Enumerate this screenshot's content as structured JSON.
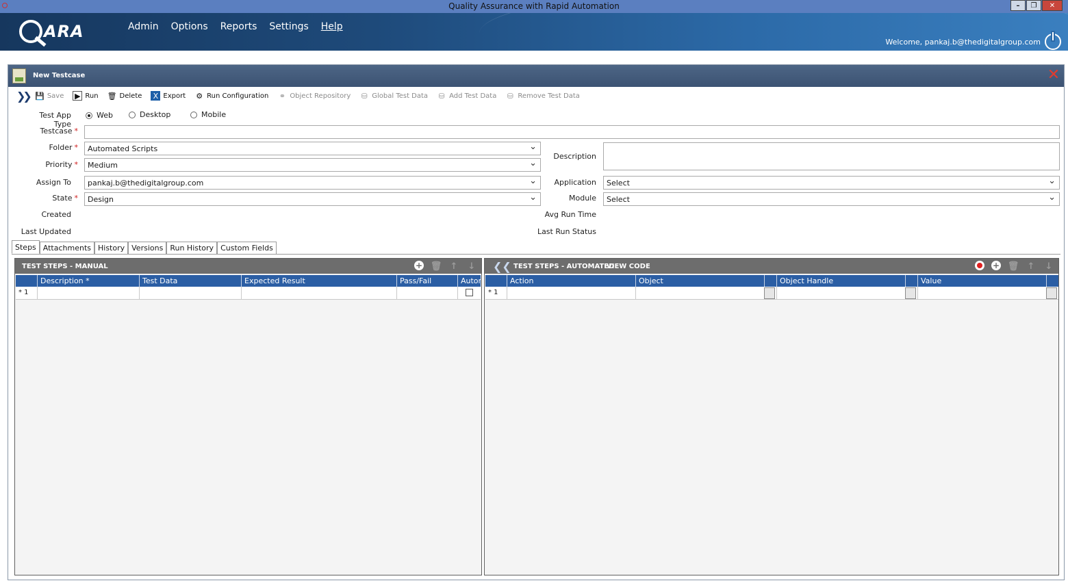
{
  "window": {
    "title": "Quality Assurance with Rapid Automation"
  },
  "header": {
    "logo_text": "ARA",
    "menu": [
      "Admin",
      "Options",
      "Reports",
      "Settings",
      "Help"
    ],
    "welcome": "Welcome, pankaj.b@thedigitalgroup.com"
  },
  "panel": {
    "title": "New Testcase"
  },
  "toolbar": {
    "save": "Save",
    "run": "Run",
    "delete": "Delete",
    "export": "Export",
    "run_configuration": "Run Configuration",
    "object_repository": "Object Repository",
    "global_test_data": "Global Test Data",
    "add_test_data": "Add Test Data",
    "remove_test_data": "Remove Test Data"
  },
  "form": {
    "app_type_label": "Test App Type",
    "app_types": [
      "Web",
      "Desktop",
      "Mobile"
    ],
    "selected_app_type": "Web",
    "testcase_label": "Testcase",
    "testcase_value": "",
    "folder_label": "Folder",
    "folder_value": "Automated Scripts",
    "priority_label": "Priority",
    "priority_value": "Medium",
    "assign_label": "Assign To",
    "assign_value": "pankaj.b@thedigitalgroup.com",
    "state_label": "State",
    "state_value": "Design",
    "created_label": "Created",
    "updated_label": "Last Updated",
    "description_label": "Description",
    "application_label": "Application",
    "application_value": "Select",
    "module_label": "Module",
    "module_value": "Select",
    "avg_run_label": "Avg Run Time",
    "last_status_label": "Last Run Status"
  },
  "tabs": [
    "Steps",
    "Attachments",
    "History",
    "Versions",
    "Run History",
    "Custom Fields"
  ],
  "manual": {
    "title": "TEST STEPS - MANUAL",
    "columns": [
      "Description *",
      "Test Data",
      "Expected Result",
      "Pass/Fail",
      "Autor"
    ],
    "row_marker": "* 1"
  },
  "automated": {
    "title": "TEST STEPS - AUTOMATED",
    "view_code": "VIEW CODE",
    "columns": [
      "Action",
      "Object",
      "Object Handle",
      "Value"
    ],
    "row_marker": "* 1"
  },
  "colors": {
    "header_blue": "#1e4a7a",
    "grid_header": "#2b5ea4",
    "record_red": "#e02020"
  }
}
